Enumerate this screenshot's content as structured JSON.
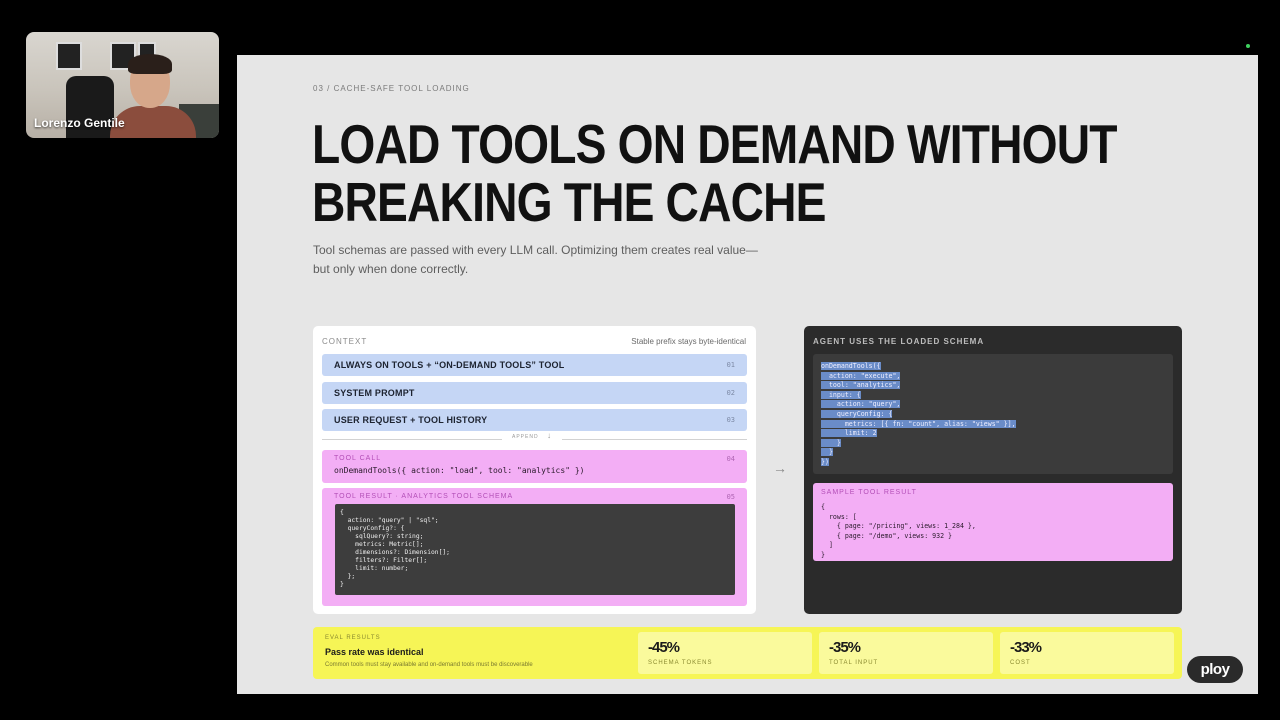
{
  "participant": {
    "name": "Lorenzo Gentile"
  },
  "slide": {
    "breadcrumb": "03 / CACHE-SAFE TOOL LOADING",
    "title_line1": "LOAD TOOLS ON DEMAND WITHOUT",
    "title_line2": "BREAKING THE CACHE",
    "subtitle_line1": "Tool schemas are passed with every LLM call. Optimizing them creates real value—",
    "subtitle_line2": "but only when done correctly."
  },
  "context": {
    "header": "CONTEXT",
    "note": "Stable prefix stays byte-identical",
    "rows": [
      {
        "label": "ALWAYS ON TOOLS + “ON-DEMAND TOOLS” TOOL",
        "num": "01"
      },
      {
        "label": "SYSTEM PROMPT",
        "num": "02"
      },
      {
        "label": "USER REQUEST + TOOL HISTORY",
        "num": "03"
      }
    ],
    "append_label": "APPEND",
    "tool_call": {
      "caption": "TOOL CALL",
      "num": "04",
      "code": "onDemandTools({ action: \"load\", tool: \"analytics\" })"
    },
    "tool_result": {
      "caption": "TOOL RESULT · ANALYTICS TOOL SCHEMA",
      "num": "05",
      "code": "{\n  action: \"query\" | \"sql\";\n  queryConfig?: {\n    sqlQuery?: string;\n    metrics: Metric[];\n    dimensions?: Dimension[];\n    filters?: Filter[];\n    limit: number;\n  };\n}"
    }
  },
  "agent": {
    "header": "AGENT USES THE LOADED SCHEMA",
    "code": "onDemandTools({\n  action: \"execute\",\n  tool: \"analytics\",\n  input: {\n    action: \"query\",\n    queryConfig: {\n      metrics: [{ fn: \"count\", alias: \"views\" }],\n      limit: 2\n    }\n  }\n})",
    "sample_caption": "SAMPLE TOOL RESULT",
    "sample_code": "{\n  rows: [\n    { page: \"/pricing\", views: 1_284 },\n    { page: \"/demo\", views: 932 }\n  ]\n}"
  },
  "eval": {
    "caption": "EVAL RESULTS",
    "headline": "Pass rate was identical",
    "detail": "Common tools must stay available and on-demand tools must be discoverable",
    "metrics": [
      {
        "value": "-45%",
        "label": "SCHEMA TOKENS"
      },
      {
        "value": "-35%",
        "label": "TOTAL INPUT"
      },
      {
        "value": "-33%",
        "label": "COST"
      }
    ]
  },
  "logo": {
    "text": "ploy"
  },
  "icons": {
    "arrow_right": "arrow-right-icon",
    "arrow_down": "arrow-down-icon"
  },
  "colors": {
    "blue_row": "#c5d6f5",
    "pink": "#f3aef5",
    "yellow": "#f6f556",
    "dark_panel": "#2b2b2b"
  }
}
